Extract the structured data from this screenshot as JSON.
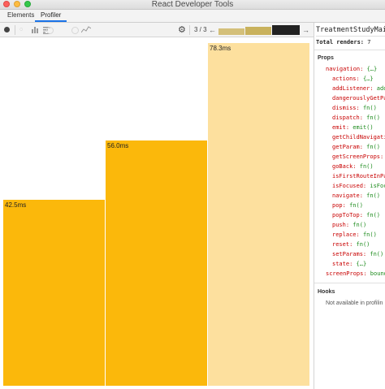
{
  "window": {
    "title": "React Developer Tools"
  },
  "tabs": [
    {
      "label": "Elements"
    },
    {
      "label": "Profiler"
    }
  ],
  "toolbar": {
    "commit_counter": "3 / 3",
    "prev_arrow": "←",
    "next_arrow": "→",
    "commit_bar_colors": [
      "#d4c07a",
      "#c9b25d",
      "#222222"
    ]
  },
  "flamegraph": {
    "bars": [
      {
        "label": "42.5ms",
        "duration_ms": 42.5,
        "color": "#fbb80b",
        "selected": false
      },
      {
        "label": "56.0ms",
        "duration_ms": 56.0,
        "color": "#fbb80b",
        "selected": false
      },
      {
        "label": "78.3ms",
        "duration_ms": 78.3,
        "color": "#fde09e",
        "selected": true
      }
    ]
  },
  "side_panel": {
    "component_name": "TreatmentStudyMai",
    "total_renders_label": "Total renders:",
    "total_renders_value": "7",
    "props_header": "Props",
    "props": [
      {
        "key": "navigation:",
        "value": "{…}"
      },
      {
        "key": "actions:",
        "value": "{…}"
      },
      {
        "key": "addListener:",
        "value": "addL"
      },
      {
        "key": "dangerouslyGetPa",
        "value": ""
      },
      {
        "key": "dismiss:",
        "value": "fn()"
      },
      {
        "key": "dispatch:",
        "value": "fn()"
      },
      {
        "key": "emit:",
        "value": "emit()"
      },
      {
        "key": "getChildNavigatio",
        "value": ""
      },
      {
        "key": "getParam:",
        "value": "fn()"
      },
      {
        "key": "getScreenProps:",
        "value": "f"
      },
      {
        "key": "goBack:",
        "value": "fn()"
      },
      {
        "key": "isFirstRouteInPa",
        "value": ""
      },
      {
        "key": "isFocused:",
        "value": "isFocu"
      },
      {
        "key": "navigate:",
        "value": "fn()"
      },
      {
        "key": "pop:",
        "value": "fn()"
      },
      {
        "key": "popToTop:",
        "value": "fn()"
      },
      {
        "key": "push:",
        "value": "fn()"
      },
      {
        "key": "replace:",
        "value": "fn()"
      },
      {
        "key": "reset:",
        "value": "fn()"
      },
      {
        "key": "setParams:",
        "value": "fn()"
      },
      {
        "key": "state:",
        "value": "{…}"
      },
      {
        "key": "screenProps:",
        "value": "bound"
      }
    ],
    "hooks_header": "Hooks",
    "hooks_message": "Not available in profilin"
  }
}
